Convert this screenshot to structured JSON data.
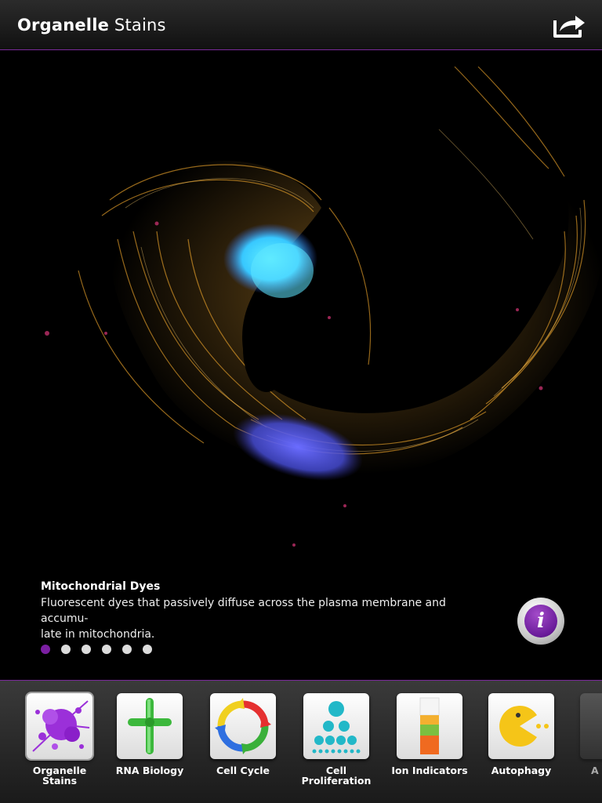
{
  "header": {
    "title_bold": "Organelle",
    "title_rest": " Stains",
    "share_icon": "share-icon"
  },
  "hero": {
    "caption_title": "Mitochondrial Dyes",
    "caption_desc_line1": "Fluorescent dyes that passively diffuse across the plasma membrane and accumu-",
    "caption_desc_line2": "late in mitochondria.",
    "info_label": "i",
    "pages": 6,
    "current_page": 1
  },
  "tabs": [
    {
      "line1": "Organelle",
      "line2": "Stains",
      "icon": "ink-splash-icon",
      "selected": true
    },
    {
      "line1": "RNA Biology",
      "line2": "",
      "icon": "trna-icon",
      "selected": false
    },
    {
      "line1": "Cell Cycle",
      "line2": "",
      "icon": "cycle-arrows-icon",
      "selected": false
    },
    {
      "line1": "Cell",
      "line2": "Proliferation",
      "icon": "cell-pyramid-icon",
      "selected": false
    },
    {
      "line1": "Ion Indicators",
      "line2": "",
      "icon": "color-bar-icon",
      "selected": false
    },
    {
      "line1": "Autophagy",
      "line2": "",
      "icon": "pacman-icon",
      "selected": false
    },
    {
      "line1": "A",
      "line2": "",
      "icon": "partial-tab-icon",
      "selected": false
    }
  ],
  "colors": {
    "accent": "#7b1fa2",
    "header_border": "#7a2a9a"
  }
}
